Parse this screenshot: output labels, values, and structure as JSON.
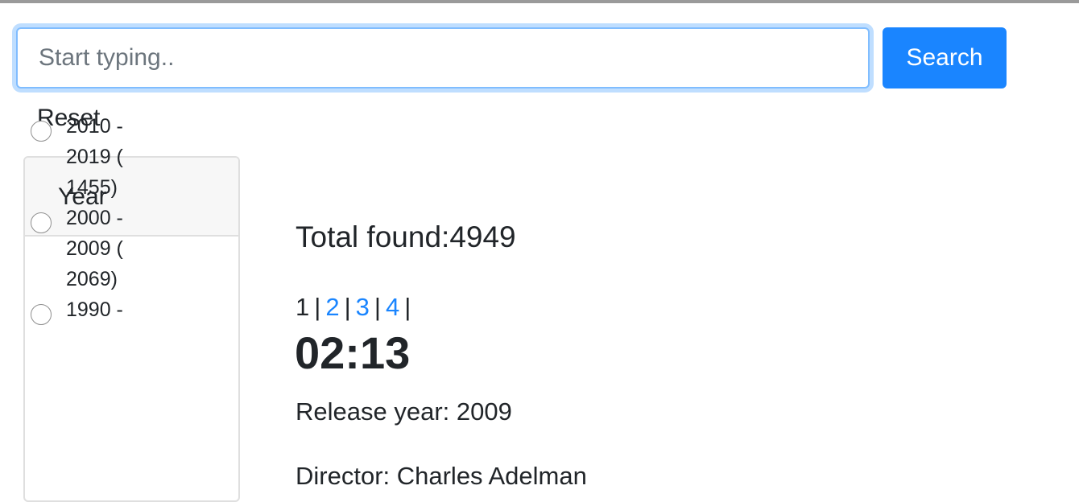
{
  "search": {
    "placeholder": "Start typing..",
    "value": "",
    "button_label": "Search"
  },
  "reset_label": "Reset",
  "filter": {
    "title": "Year",
    "options": [
      {
        "label": "2010 - 2019 ( 1455)",
        "selected": false
      },
      {
        "label": "2000 - 2009 ( 2069)",
        "selected": false
      },
      {
        "label": "1990 -",
        "selected": false
      }
    ]
  },
  "results": {
    "total_label": "Total found:",
    "total_count": "4949",
    "pages": [
      "1",
      "2",
      "3",
      "4"
    ],
    "current_page": "1",
    "separator": "|",
    "item": {
      "title": "02:13",
      "release": "Release year: 2009",
      "director": "Director: Charles Adelman"
    }
  },
  "colors": {
    "accent": "#1a85ff",
    "focus_ring": "#80bdff",
    "card_header_bg": "#f7f7f7",
    "card_border": "#dfdfdf",
    "text": "#212529"
  }
}
